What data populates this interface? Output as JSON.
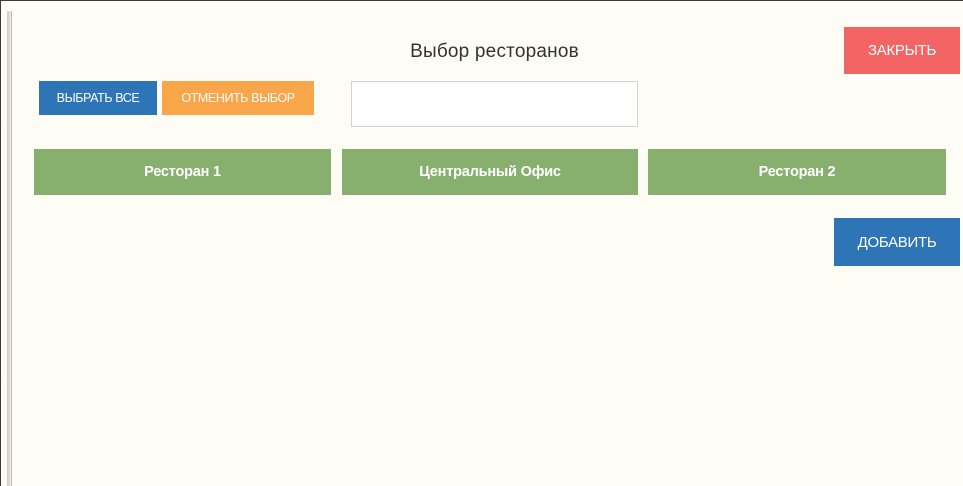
{
  "dialog": {
    "title": "Выбор ресторанов",
    "close_label": "ЗАКРЫТЬ",
    "select_all_label": "ВЫБРАТЬ ВСЕ",
    "deselect_label": "ОТМЕНИТЬ ВЫБОР",
    "search": {
      "value": "",
      "placeholder": ""
    },
    "restaurants": [
      {
        "label": "Ресторан 1"
      },
      {
        "label": "Центральный Офис"
      },
      {
        "label": "Ресторан 2"
      }
    ],
    "add_label": "ДОБАВИТЬ"
  },
  "colors": {
    "background": "#fdfdf6",
    "close_button": "#f36464",
    "primary_button": "#2e75b8",
    "deselect_button": "#f9a64a",
    "restaurant_tile": "#87b06f"
  }
}
